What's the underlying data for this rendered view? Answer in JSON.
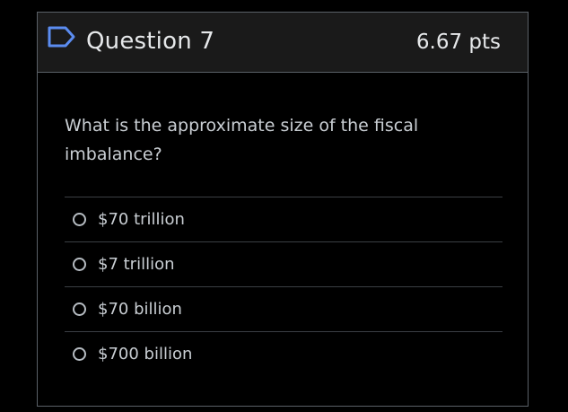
{
  "question": {
    "flag_icon": "bookmark-flag-icon",
    "title": "Question 7",
    "points": "6.67 pts",
    "prompt": "What is the approximate size of the fiscal imbalance?",
    "answers": [
      {
        "label": "$70 trillion"
      },
      {
        "label": "$7 trillion"
      },
      {
        "label": "$70 billion"
      },
      {
        "label": "$700 billion"
      }
    ]
  },
  "colors": {
    "background": "#000000",
    "header_bg": "#1a1a1a",
    "border": "#5b6168",
    "text": "#c9ced3",
    "flag_outline": "#5b8cf0"
  }
}
